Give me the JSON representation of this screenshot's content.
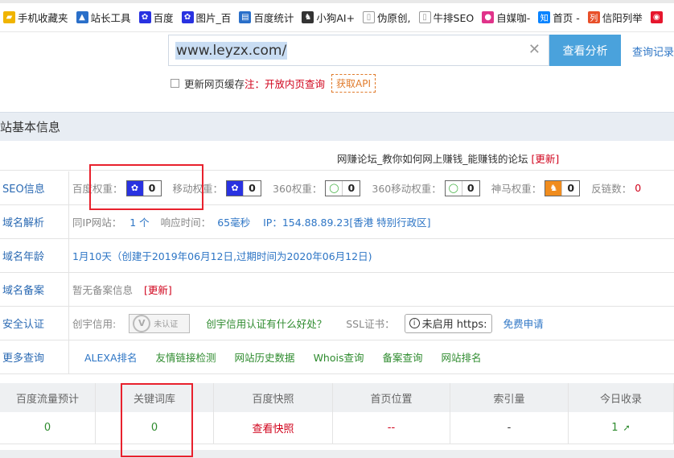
{
  "bookmarks": [
    {
      "label": "手机收藏夹",
      "icon": "folder-icon",
      "color": "#f0b400"
    },
    {
      "label": "站长工具",
      "icon": "chart-icon",
      "color": "#2a6fc9"
    },
    {
      "label": "百度",
      "icon": "baidu-paw-icon",
      "color": "#2932e1"
    },
    {
      "label": "图片_百",
      "icon": "baidu-paw-icon",
      "color": "#2932e1"
    },
    {
      "label": "百度统计",
      "icon": "stats-icon",
      "color": "#2a6fc9"
    },
    {
      "label": "小狗AI+",
      "icon": "dog-icon",
      "color": "#333333"
    },
    {
      "label": "伪原创,",
      "icon": "page-icon",
      "color": "#999999"
    },
    {
      "label": "牛排SEO",
      "icon": "page-icon",
      "color": "#999999"
    },
    {
      "label": "自媒咖-",
      "icon": "media-icon",
      "color": "#e0338a"
    },
    {
      "label": "首页 -",
      "icon": "zhihu-icon",
      "color": "#0a84ff"
    },
    {
      "label": "信阳列举",
      "icon": "list-icon",
      "color": "#e8502a"
    },
    {
      "label": "",
      "icon": "weibo-icon",
      "color": "#e6162d"
    }
  ],
  "search": {
    "value": "www.leyzx.com/",
    "button": "查看分析",
    "history_link": "查询记录",
    "refresh_label": "更新网页缓存",
    "refresh_note": "注：开放内页查询",
    "api_button": "获取API"
  },
  "info": {
    "header": "站基本信息",
    "site_title": "网赚论坛_教你如何网上赚钱_能赚钱的论坛",
    "site_update": "[更新]"
  },
  "seo": {
    "label": "SEO信息",
    "items": [
      {
        "name": "百度权重：",
        "value": "0",
        "icon": "baidu-paw-icon"
      },
      {
        "name": "移动权重：",
        "value": "0",
        "icon": "baidu-paw-icon"
      },
      {
        "name": "360权重：",
        "value": "0",
        "icon": "360-icon"
      },
      {
        "name": "360移动权重：",
        "value": "0",
        "icon": "360-icon"
      },
      {
        "name": "神马权重：",
        "value": "0",
        "icon": "shenma-icon"
      }
    ],
    "backlinks_label": "反链数：",
    "backlinks_value": "0"
  },
  "dns": {
    "label": "域名解析",
    "same_ip_label": "同IP网站：",
    "same_ip_value": "1 个",
    "response_label": "响应时间：",
    "response_value": "65毫秒",
    "ip_text": "IP：154.88.89.23[香港 特别行政区]"
  },
  "age": {
    "label": "域名年龄",
    "text": "1月10天（创建于2019年06月12日,过期时间为2020年06月12日)"
  },
  "icp": {
    "label": "域名备案",
    "text": "暂无备案信息",
    "update": "[更新]"
  },
  "security": {
    "label": "安全认证",
    "chuangyu_label": "创宇信用:",
    "badge_text": "未认证",
    "chuangyu_link": "创宇信用认证有什么好处？",
    "ssl_label": "SSL证书：",
    "ssl_status": "未启用 https:",
    "ssl_apply": "免费申请"
  },
  "more": {
    "label": "更多查询",
    "links": [
      "ALEXA排名",
      "友情链接检测",
      "网站历史数据",
      "Whois查询",
      "备案查询",
      "网站排名"
    ]
  },
  "stats": {
    "headers": [
      "百度流量预计",
      "关键词库",
      "百度快照",
      "首页位置",
      "索引量",
      "今日收录"
    ],
    "values": [
      "0",
      "0",
      "查看快照",
      "--",
      "-",
      "1"
    ],
    "value_colors": [
      "#2e8b2e",
      "#2e8b2e",
      "#d0021b",
      "#d0021b",
      "#333333",
      "#2e8b2e"
    ],
    "today_arrow": "up-arrow-icon"
  }
}
